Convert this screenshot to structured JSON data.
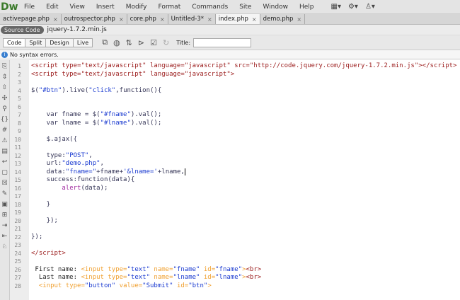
{
  "app": {
    "logo": "Dw",
    "menu": [
      "File",
      "Edit",
      "View",
      "Insert",
      "Modify",
      "Format",
      "Commands",
      "Site",
      "Window",
      "Help"
    ],
    "menu_icons": [
      "layout-icon",
      "gear-icon",
      "user-icon"
    ]
  },
  "tabs": [
    {
      "label": "activepage.php",
      "active": false
    },
    {
      "label": "outrospector.php",
      "active": false
    },
    {
      "label": "core.php",
      "active": false
    },
    {
      "label": "Untitled-3*",
      "active": false
    },
    {
      "label": "index.php",
      "active": true
    },
    {
      "label": "demo.php",
      "active": false
    }
  ],
  "source_bar": {
    "source_code": "Source Code",
    "related_file": "jquery-1.7.2.min.js"
  },
  "toolbar": {
    "views": [
      "Code",
      "Split",
      "Design",
      "Live"
    ],
    "active_view": "Code",
    "title_label": "Title:",
    "title_value": ""
  },
  "status": {
    "message": "No syntax errors."
  },
  "editor": {
    "lines": [
      [
        [
          "<script type=\"text/javascript\" language=\"javascript\" src=\"http://code.jquery.com/jquery-1.7.2.min.js\"></script>",
          "tag"
        ]
      ],
      [
        [
          "<script type=\"text/javascript\" language=\"javascript\">",
          "tag"
        ]
      ],
      [],
      [
        [
          "$(",
          "js"
        ],
        [
          "\"#btn\"",
          "str"
        ],
        [
          ").live(",
          "js"
        ],
        [
          "\"click\"",
          "str"
        ],
        [
          ",function(){",
          "js"
        ]
      ],
      [],
      [],
      [
        [
          "    var fname = $(",
          "js"
        ],
        [
          "\"#fname\"",
          "str"
        ],
        [
          ").val();",
          "js"
        ]
      ],
      [
        [
          "    var lname = $(",
          "js"
        ],
        [
          "\"#lname\"",
          "str"
        ],
        [
          ").val();",
          "js"
        ]
      ],
      [],
      [
        [
          "    $.ajax({",
          "js"
        ]
      ],
      [],
      [
        [
          "    type:",
          "js"
        ],
        [
          "\"POST\"",
          "str"
        ],
        [
          ",",
          "js"
        ]
      ],
      [
        [
          "    url:",
          "js"
        ],
        [
          "\"demo.php\"",
          "str"
        ],
        [
          ",",
          "js"
        ]
      ],
      [
        [
          "    data:",
          "js"
        ],
        [
          "\"fname=\"",
          "str"
        ],
        [
          "+fname+",
          "js"
        ],
        [
          "'&lname='",
          "str"
        ],
        [
          "+lname,",
          "js"
        ]
      ],
      [
        [
          "    success:function(data){",
          "js"
        ]
      ],
      [
        [
          "        ",
          "js"
        ],
        [
          "alert",
          "fn"
        ],
        [
          "(data);",
          "js"
        ]
      ],
      [],
      [
        [
          "    }",
          "js"
        ]
      ],
      [],
      [
        [
          "    });",
          "js"
        ]
      ],
      [],
      [
        [
          "});",
          "js"
        ]
      ],
      [],
      [
        [
          "</script>",
          "tag"
        ]
      ],
      [],
      [
        [
          " First name: ",
          "txt"
        ],
        [
          "<input type=",
          "html"
        ],
        [
          "\"text\"",
          "str"
        ],
        [
          " name=",
          "html"
        ],
        [
          "\"fname\"",
          "str"
        ],
        [
          " id=",
          "html"
        ],
        [
          "\"fname\"",
          "str"
        ],
        [
          ">",
          "html"
        ],
        [
          "<br>",
          "tag"
        ]
      ],
      [
        [
          "  Last name: ",
          "txt"
        ],
        [
          "<input type=",
          "html"
        ],
        [
          "\"text\"",
          "str"
        ],
        [
          " name=",
          "html"
        ],
        [
          "\"lname\"",
          "str"
        ],
        [
          " id=",
          "html"
        ],
        [
          "\"lname\"",
          "str"
        ],
        [
          ">",
          "html"
        ],
        [
          "<br>",
          "tag"
        ]
      ],
      [
        [
          "  ",
          "txt"
        ],
        [
          "<input type=",
          "html"
        ],
        [
          "\"button\"",
          "str"
        ],
        [
          " value=",
          "html"
        ],
        [
          "\"Submit\"",
          "str"
        ],
        [
          " id=",
          "html"
        ],
        [
          "\"btn\"",
          "str"
        ],
        [
          ">",
          "html"
        ]
      ]
    ],
    "cursor_line": 14
  }
}
